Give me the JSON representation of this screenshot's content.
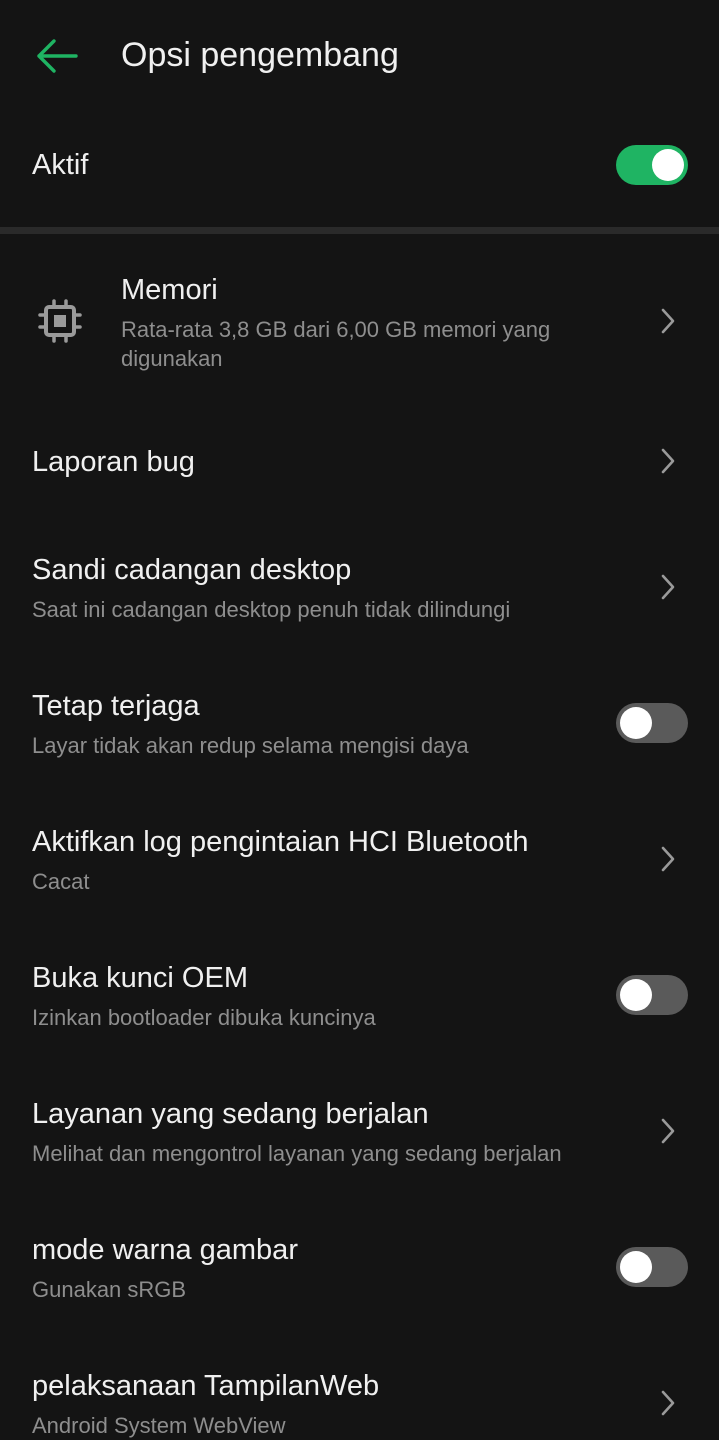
{
  "header": {
    "title": "Opsi pengembang",
    "back_icon": "arrow-left-icon",
    "accent": "#1fb463"
  },
  "master": {
    "label": "Aktif",
    "enabled": true
  },
  "items": [
    {
      "title": "Memori",
      "subtitle": "Rata-rata 3,8 GB dari 6,00 GB memori yang digunakan",
      "icon": "memory-chip-icon",
      "control": "chevron"
    },
    {
      "title": "Laporan bug",
      "subtitle": "",
      "control": "chevron"
    },
    {
      "title": "Sandi cadangan desktop",
      "subtitle": "Saat ini cadangan desktop penuh tidak dilindungi",
      "control": "chevron"
    },
    {
      "title": "Tetap terjaga",
      "subtitle": "Layar tidak akan redup selama mengisi daya",
      "control": "toggle",
      "enabled": false
    },
    {
      "title": "Aktifkan log pengintaian HCI Bluetooth",
      "subtitle": "Cacat",
      "control": "chevron"
    },
    {
      "title": "Buka kunci OEM",
      "subtitle": "Izinkan bootloader dibuka kuncinya",
      "control": "toggle",
      "enabled": false
    },
    {
      "title": "Layanan yang sedang berjalan",
      "subtitle": "Melihat dan mengontrol layanan yang sedang berjalan",
      "control": "chevron"
    },
    {
      "title": "mode warna gambar",
      "subtitle": "Gunakan sRGB",
      "control": "toggle",
      "enabled": false
    },
    {
      "title": "pelaksanaan TampilanWeb",
      "subtitle": "Android System WebView",
      "control": "chevron"
    }
  ]
}
